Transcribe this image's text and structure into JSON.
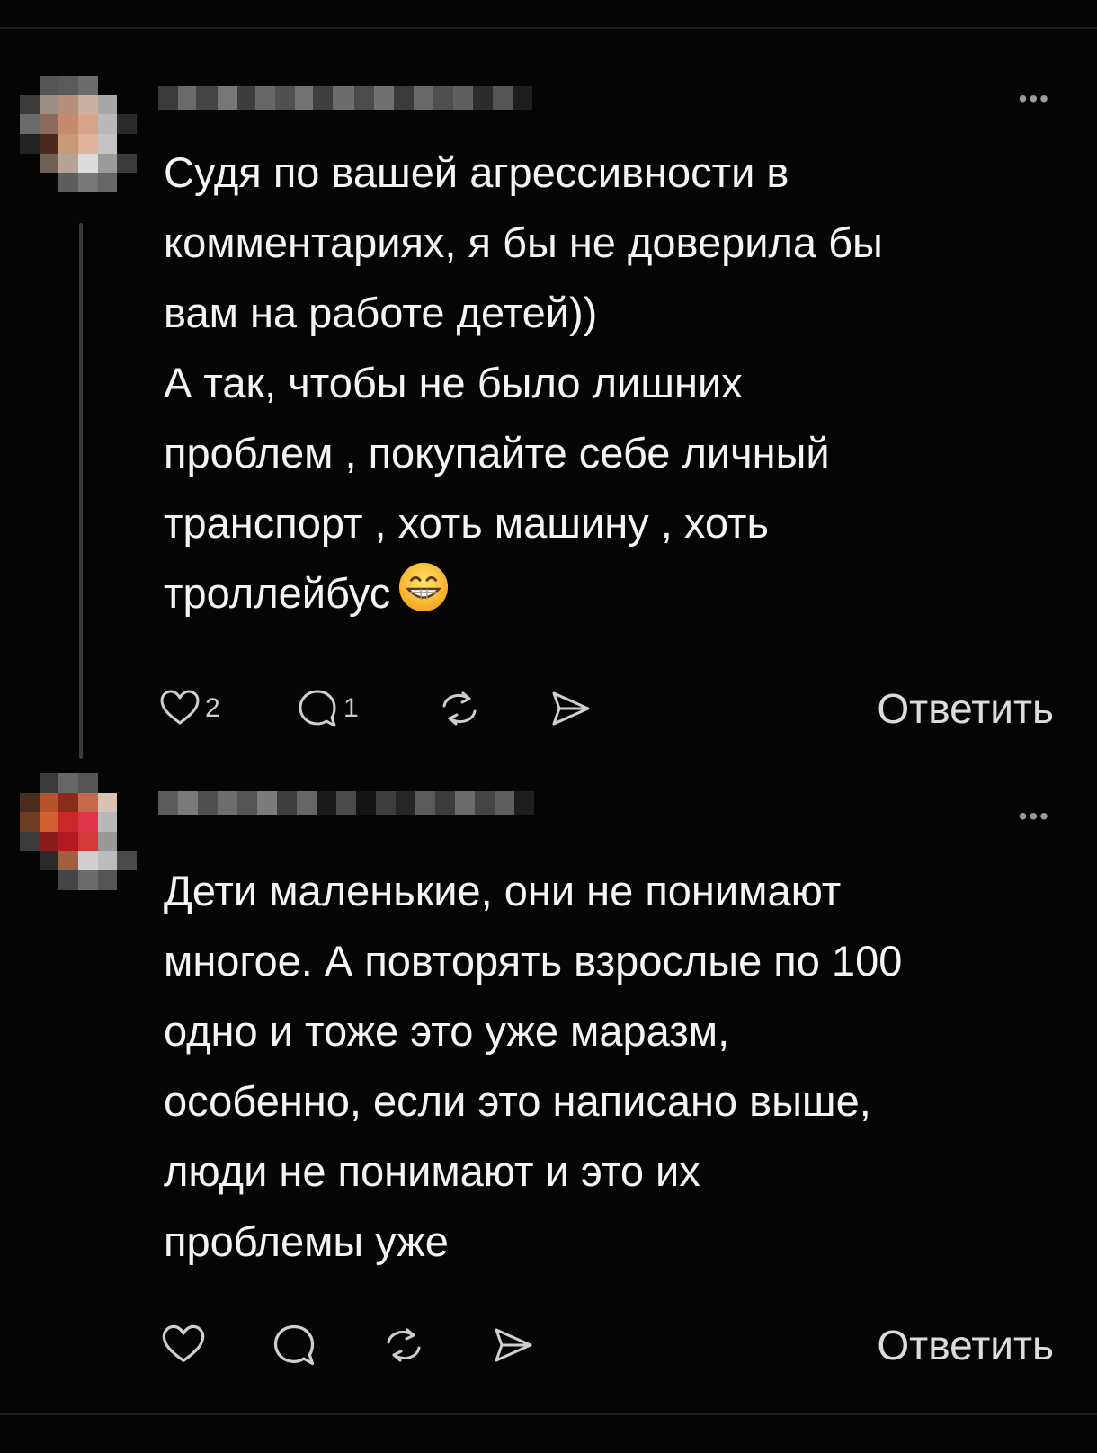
{
  "comments": [
    {
      "more_label": "•••",
      "text_lines": [
        "Судя по вашей агрессивности в",
        "комментариях, я бы не доверила бы",
        "вам на работе детей))",
        "А так, чтобы не было лишних",
        "проблем , покупайте себе личный",
        "транспорт , хоть машину , хоть",
        "троллейбус"
      ],
      "emoji_icon": "grinning-face-emoji",
      "likes": "2",
      "replies": "1",
      "reply_label": "Ответить"
    },
    {
      "more_label": "•••",
      "text_lines": [
        "Дети маленькие, они не понимают",
        "многое. А повторять взрослые по 100",
        "одно и тоже это уже маразм,",
        "особенно, если это написано выше,",
        "люди не понимают и это их",
        "проблемы уже"
      ],
      "reply_label": "Ответить"
    }
  ],
  "icons": {
    "like": "heart-icon",
    "comment": "speech-bubble-icon",
    "repost": "repost-icon",
    "share": "send-arrow-icon"
  }
}
